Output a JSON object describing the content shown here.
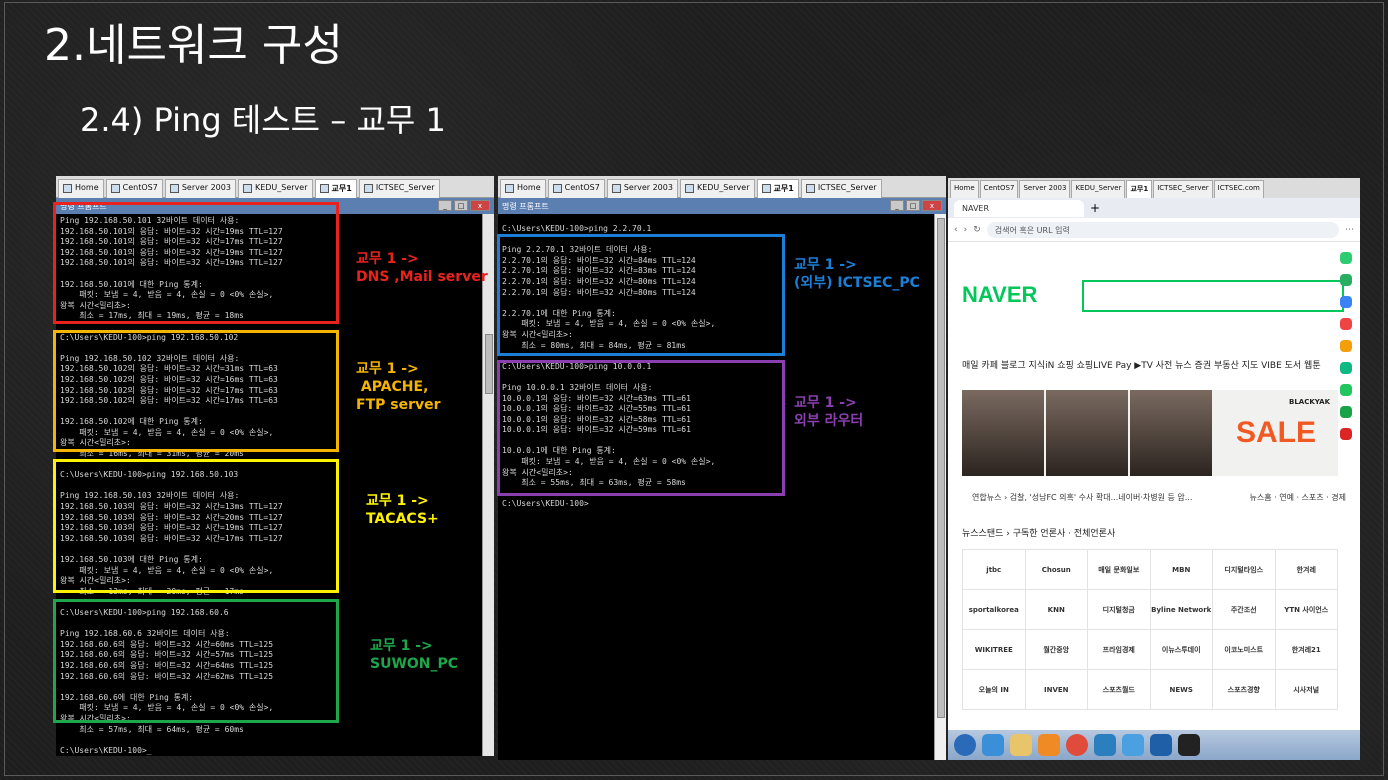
{
  "slide": {
    "title": "2.네트워크 구성",
    "subtitle": "2.4) Ping 테스트 – 교무 1"
  },
  "vm_left": {
    "tabs": [
      "Home",
      "CentOS7",
      "Server 2003",
      "KEDU_Server",
      "교무1",
      "ICTSEC_Server"
    ],
    "window_title": "명령 프롬프트",
    "console": "Ping 192.168.50.101 32바이트 데이터 사용:\n192.168.50.101의 응답: 바이트=32 시간=19ms TTL=127\n192.168.50.101의 응답: 바이트=32 시간=17ms TTL=127\n192.168.50.101의 응답: 바이트=32 시간=19ms TTL=127\n192.168.50.101의 응답: 바이트=32 시간=19ms TTL=127\n\n192.168.50.101에 대한 Ping 통계:\n    패킷: 보냄 = 4, 받음 = 4, 손실 = 0 <0% 손실>,\n왕복 시간<밀리초>:\n    최소 = 17ms, 최대 = 19ms, 평균 = 18ms\n\nC:\\Users\\KEDU-100>ping 192.168.50.102\n\nPing 192.168.50.102 32바이트 데이터 사용:\n192.168.50.102의 응답: 바이트=32 시간=31ms TTL=63\n192.168.50.102의 응답: 바이트=32 시간=16ms TTL=63\n192.168.50.102의 응답: 바이트=32 시간=17ms TTL=63\n192.168.50.102의 응답: 바이트=32 시간=17ms TTL=63\n\n192.168.50.102에 대한 Ping 통계:\n    패킷: 보냄 = 4, 받음 = 4, 손실 = 0 <0% 손실>,\n왕복 시간<밀리초>:\n    최소 = 16ms, 최대 = 31ms, 평균 = 20ms\n\nC:\\Users\\KEDU-100>ping 192.168.50.103\n\nPing 192.168.50.103 32바이트 데이터 사용:\n192.168.50.103의 응답: 바이트=32 시간=13ms TTL=127\n192.168.50.103의 응답: 바이트=32 시간=20ms TTL=127\n192.168.50.103의 응답: 바이트=32 시간=19ms TTL=127\n192.168.50.103의 응답: 바이트=32 시간=17ms TTL=127\n\n192.168.50.103에 대한 Ping 통계:\n    패킷: 보냄 = 4, 받음 = 4, 손실 = 0 <0% 손실>,\n왕복 시간<밀리초>:\n    최소 = 13ms, 최대 = 20ms, 평균 = 17ms\n\nC:\\Users\\KEDU-100>ping 192.168.60.6\n\nPing 192.168.60.6 32바이트 데이터 사용:\n192.168.60.6의 응답: 바이트=32 시간=60ms TTL=125\n192.168.60.6의 응답: 바이트=32 시간=57ms TTL=125\n192.168.60.6의 응답: 바이트=32 시간=64ms TTL=125\n192.168.60.6의 응답: 바이트=32 시간=62ms TTL=125\n\n192.168.60.6에 대한 Ping 통계:\n    패킷: 보냄 = 4, 받음 = 4, 손실 = 0 <0% 손실>,\n왕복 시간<밀리초>:\n    최소 = 57ms, 최대 = 64ms, 평균 = 60ms\n\nC:\\Users\\KEDU-100>_"
  },
  "vm_mid": {
    "tabs": [
      "Home",
      "CentOS7",
      "Server 2003",
      "KEDU_Server",
      "교무1",
      "ICTSEC_Server"
    ],
    "window_title": "명령 프롬프트",
    "console": "C:\\Users\\KEDU-100>ping 2.2.70.1\n\nPing 2.2.70.1 32바이트 데이터 사용:\n2.2.70.1의 응답: 바이트=32 시간=84ms TTL=124\n2.2.70.1의 응답: 바이트=32 시간=83ms TTL=124\n2.2.70.1의 응답: 바이트=32 시간=80ms TTL=124\n2.2.70.1의 응답: 바이트=32 시간=80ms TTL=124\n\n2.2.70.1에 대한 Ping 통계:\n    패킷: 보냄 = 4, 받음 = 4, 손실 = 0 <0% 손실>,\n왕복 시간<밀리초>:\n    최소 = 80ms, 최대 = 84ms, 평균 = 81ms\n\nC:\\Users\\KEDU-100>ping 10.0.0.1\n\nPing 10.0.0.1 32바이트 데이터 사용:\n10.0.0.1의 응답: 바이트=32 시간=63ms TTL=61\n10.0.0.1의 응답: 바이트=32 시간=55ms TTL=61\n10.0.0.1의 응답: 바이트=32 시간=58ms TTL=61\n10.0.0.1의 응답: 바이트=32 시간=59ms TTL=61\n\n10.0.0.1에 대한 Ping 통계:\n    패킷: 보냄 = 4, 받음 = 4, 손실 = 0 <0% 손실>,\n왕복 시간<밀리초>:\n    최소 = 55ms, 최대 = 63ms, 평균 = 58ms\n\nC:\\Users\\KEDU-100>"
  },
  "annotations": {
    "a1": {
      "text": "교무 1 ->\nDNS ,Mail server",
      "color": "#e8231d"
    },
    "a2": {
      "text": "교무 1 ->\n APACHE,\nFTP server",
      "color": "#f4b400"
    },
    "a3": {
      "text": "교무 1 ->\nTACACS+",
      "color": "#fff200"
    },
    "a4": {
      "text": "교무 1 ->\nSUWON_PC",
      "color": "#1da64a"
    },
    "a5": {
      "text": "교무 1 ->\n(외부) ICTSEC_PC",
      "color": "#1c7fd6"
    },
    "a6": {
      "text": "교무 1 ->\n외부 라우터",
      "color": "#8a3fb0"
    }
  },
  "browser": {
    "tabs": [
      "Home",
      "CentOS7",
      "Server 2003",
      "KEDU_Server",
      "교무1",
      "ICTSEC_Server",
      "ICTSEC.com"
    ],
    "page_tab": "NAVER",
    "url_placeholder": "검색어 혹은 URL 입력",
    "logo": "NAVER",
    "menu": "매일  카페  블로그  지식iN  쇼핑  쇼핑LIVE  Pay  ▶TV  사전  뉴스  증권  부동산  지도  VIBE  도서  웹툰",
    "banner_sale": "SALE",
    "banner_brand": "BLACKYAK",
    "news_left": "연합뉴스 › 검찰, '성남FC 의혹' 수사 확대...네이버·차병원 등 압...",
    "news_right": "뉴스홈 · 연예 · 스포츠 · 경제",
    "newsstand": "뉴스스탠드 › 구독한 언론사 · 전체언론사",
    "press": [
      "jtbc",
      "Chosun",
      "매일 문화일보",
      "MBN",
      "디지털타임스",
      "한겨레",
      "sportalkorea",
      "KNN",
      "디지털청금",
      "Byline Network",
      "주간조선",
      "YTN 사이언스",
      "WIKITREE",
      "월간중앙",
      "프라임경제",
      "이뉴스투데이",
      "이코노미스트",
      "한겨레21",
      "오늘의 IN",
      "INVEN",
      "스포츠월드",
      "NEWS",
      "스포츠경향",
      "시사저널"
    ],
    "colors": {
      "naver_green": "#03c75a",
      "sale_orange": "#f05a22"
    }
  }
}
